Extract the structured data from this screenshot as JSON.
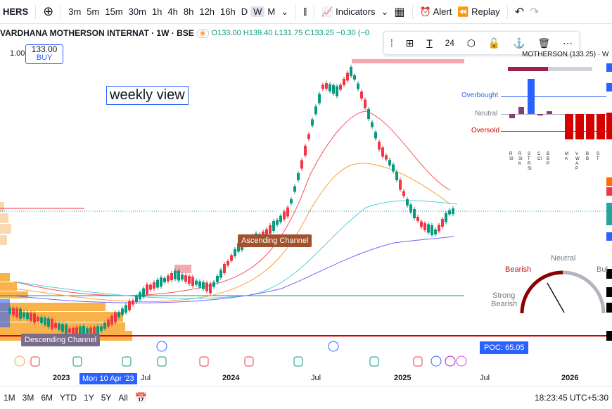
{
  "toolbar": {
    "symbol_fragment": "HERS",
    "intervals": [
      "3m",
      "5m",
      "15m",
      "30m",
      "1h",
      "4h",
      "8h",
      "12h",
      "16h",
      "D",
      "W",
      "M"
    ],
    "active_interval": "W",
    "indicators_label": "Indicators",
    "alert_label": "Alert",
    "replay_label": "Replay"
  },
  "legend": {
    "title": "VARDHANA MOTHERSON INTERNAT · 1W · BSE",
    "open": "O133.00",
    "high": "H139.40",
    "low": "L131.75",
    "close": "C133.25",
    "change": "−0.30 (−0",
    "qty": "1.00",
    "buy_price": "133.00",
    "buy_label": "BUY"
  },
  "drawing_toolbar": {
    "font_size": "24"
  },
  "annotations": {
    "weekly_note": "weekly view",
    "ascending_channel": "Ascending Channel",
    "descending_channel": "Descending Channel",
    "poc": "POC: 65.05",
    "date_badge": "Mon 10 Apr '23"
  },
  "indicator_panel": {
    "title": "MOTHERSON (133.25) · W",
    "overbought": "Overbought",
    "neutral": "Neutral",
    "oversold": "Oversold",
    "columns": [
      "RSI",
      "RSI K",
      "STRSI",
      "CCI",
      "BBP",
      "MA",
      "VWAP",
      "BB",
      "ST"
    ]
  },
  "gauge": {
    "neutral": "Neutral",
    "bearish": "Bearish",
    "strong_bearish_1": "Strong",
    "strong_bearish_2": "Bearish",
    "bullish_fragment": "Bul"
  },
  "time_axis": [
    "2023",
    "Jul",
    "2024",
    "Jul",
    "2025",
    "Jul",
    "2026"
  ],
  "bottom_bar": {
    "ranges": [
      "1M",
      "3M",
      "6M",
      "YTD",
      "1Y",
      "5Y",
      "All"
    ],
    "clock": "18:23:45 UTC+5:30"
  }
}
